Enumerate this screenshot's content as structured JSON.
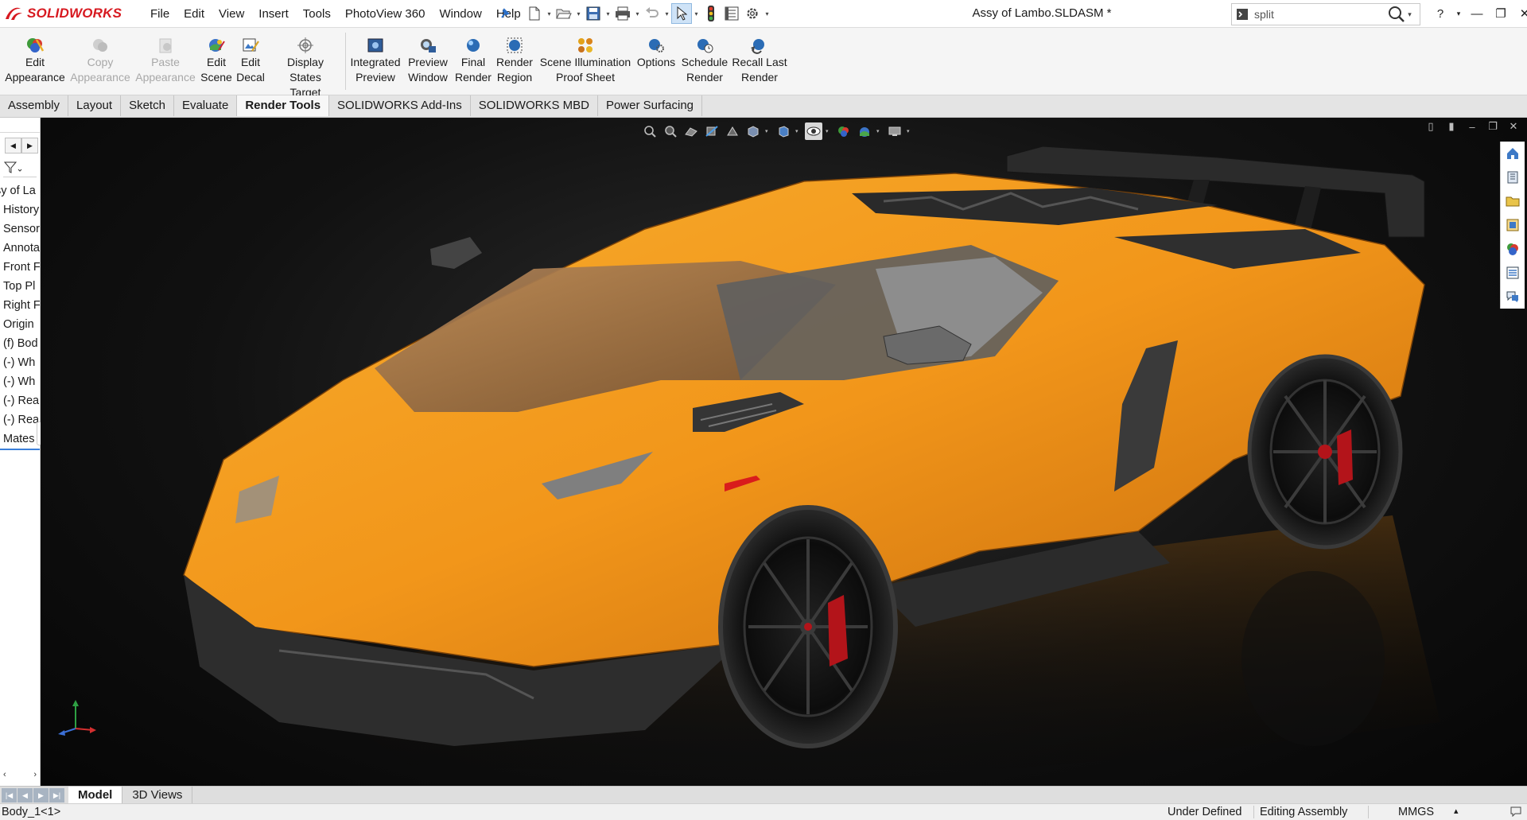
{
  "app": {
    "brand": "SOLIDWORKS",
    "document_title": "Assy of Lambo.SLDASM *",
    "brand_color": "#d71920"
  },
  "menus": [
    "File",
    "Edit",
    "View",
    "Insert",
    "Tools",
    "PhotoView 360",
    "Window",
    "Help"
  ],
  "search": {
    "value": "split",
    "placeholder": ""
  },
  "window_controls": {
    "help": "?",
    "minimize": "—",
    "restore": "❐",
    "close": "✕"
  },
  "command_manager": {
    "commands": [
      {
        "id": "edit-appearance",
        "line1": "Edit",
        "line2": "Appearance",
        "enabled": true
      },
      {
        "id": "copy-appearance",
        "line1": "Copy",
        "line2": "Appearance",
        "enabled": false
      },
      {
        "id": "paste-appearance",
        "line1": "Paste",
        "line2": "Appearance",
        "enabled": false
      },
      {
        "id": "edit-scene",
        "line1": "Edit",
        "line2": "Scene",
        "enabled": true
      },
      {
        "id": "edit-decal",
        "line1": "Edit",
        "line2": "Decal",
        "enabled": true
      },
      {
        "id": "display-states-target",
        "line1": "Display States",
        "line2": "Target",
        "enabled": true
      },
      {
        "id": "integrated-preview",
        "line1": "Integrated",
        "line2": "Preview",
        "enabled": true
      },
      {
        "id": "preview-window",
        "line1": "Preview",
        "line2": "Window",
        "enabled": true
      },
      {
        "id": "final-render",
        "line1": "Final",
        "line2": "Render",
        "enabled": true
      },
      {
        "id": "render-region",
        "line1": "Render",
        "line2": "Region",
        "enabled": true
      },
      {
        "id": "scene-illumination",
        "line1": "Scene Illumination",
        "line2": "Proof Sheet",
        "enabled": true
      },
      {
        "id": "options",
        "line1": "Options",
        "line2": "",
        "enabled": true
      },
      {
        "id": "schedule-render",
        "line1": "Schedule",
        "line2": "Render",
        "enabled": true
      },
      {
        "id": "recall-last-render",
        "line1": "Recall Last",
        "line2": "Render",
        "enabled": true
      }
    ]
  },
  "tabs": [
    {
      "label": "Assembly",
      "active": false
    },
    {
      "label": "Layout",
      "active": false
    },
    {
      "label": "Sketch",
      "active": false
    },
    {
      "label": "Evaluate",
      "active": false
    },
    {
      "label": "Render Tools",
      "active": true
    },
    {
      "label": "SOLIDWORKS Add-Ins",
      "active": false
    },
    {
      "label": "SOLIDWORKS MBD",
      "active": false
    },
    {
      "label": "Power Surfacing",
      "active": false
    }
  ],
  "feature_tree": {
    "items": [
      "sy of La",
      "History",
      "Sensor",
      "Annota",
      "Front F",
      "Top Pl",
      "Right F",
      "Origin",
      "(f) Bod",
      "(-) Wh",
      "(-) Wh",
      "(-) Rea",
      "(-) Rea",
      "Mates"
    ],
    "selected_index": 13
  },
  "bottom_tabs": [
    {
      "label": "Model",
      "active": true
    },
    {
      "label": "3D Views",
      "active": false
    }
  ],
  "status": {
    "left": "Body_1<1>",
    "state": "Under Defined",
    "mode": "Editing Assembly",
    "units": "MMGS",
    "units_arrow": "▴"
  },
  "colors": {
    "car_body": "#f39a1b",
    "car_dark": "#262626",
    "glass": "#c98a4a",
    "brake": "#b3141a",
    "tab_active_bg": "#f7f7f7"
  }
}
